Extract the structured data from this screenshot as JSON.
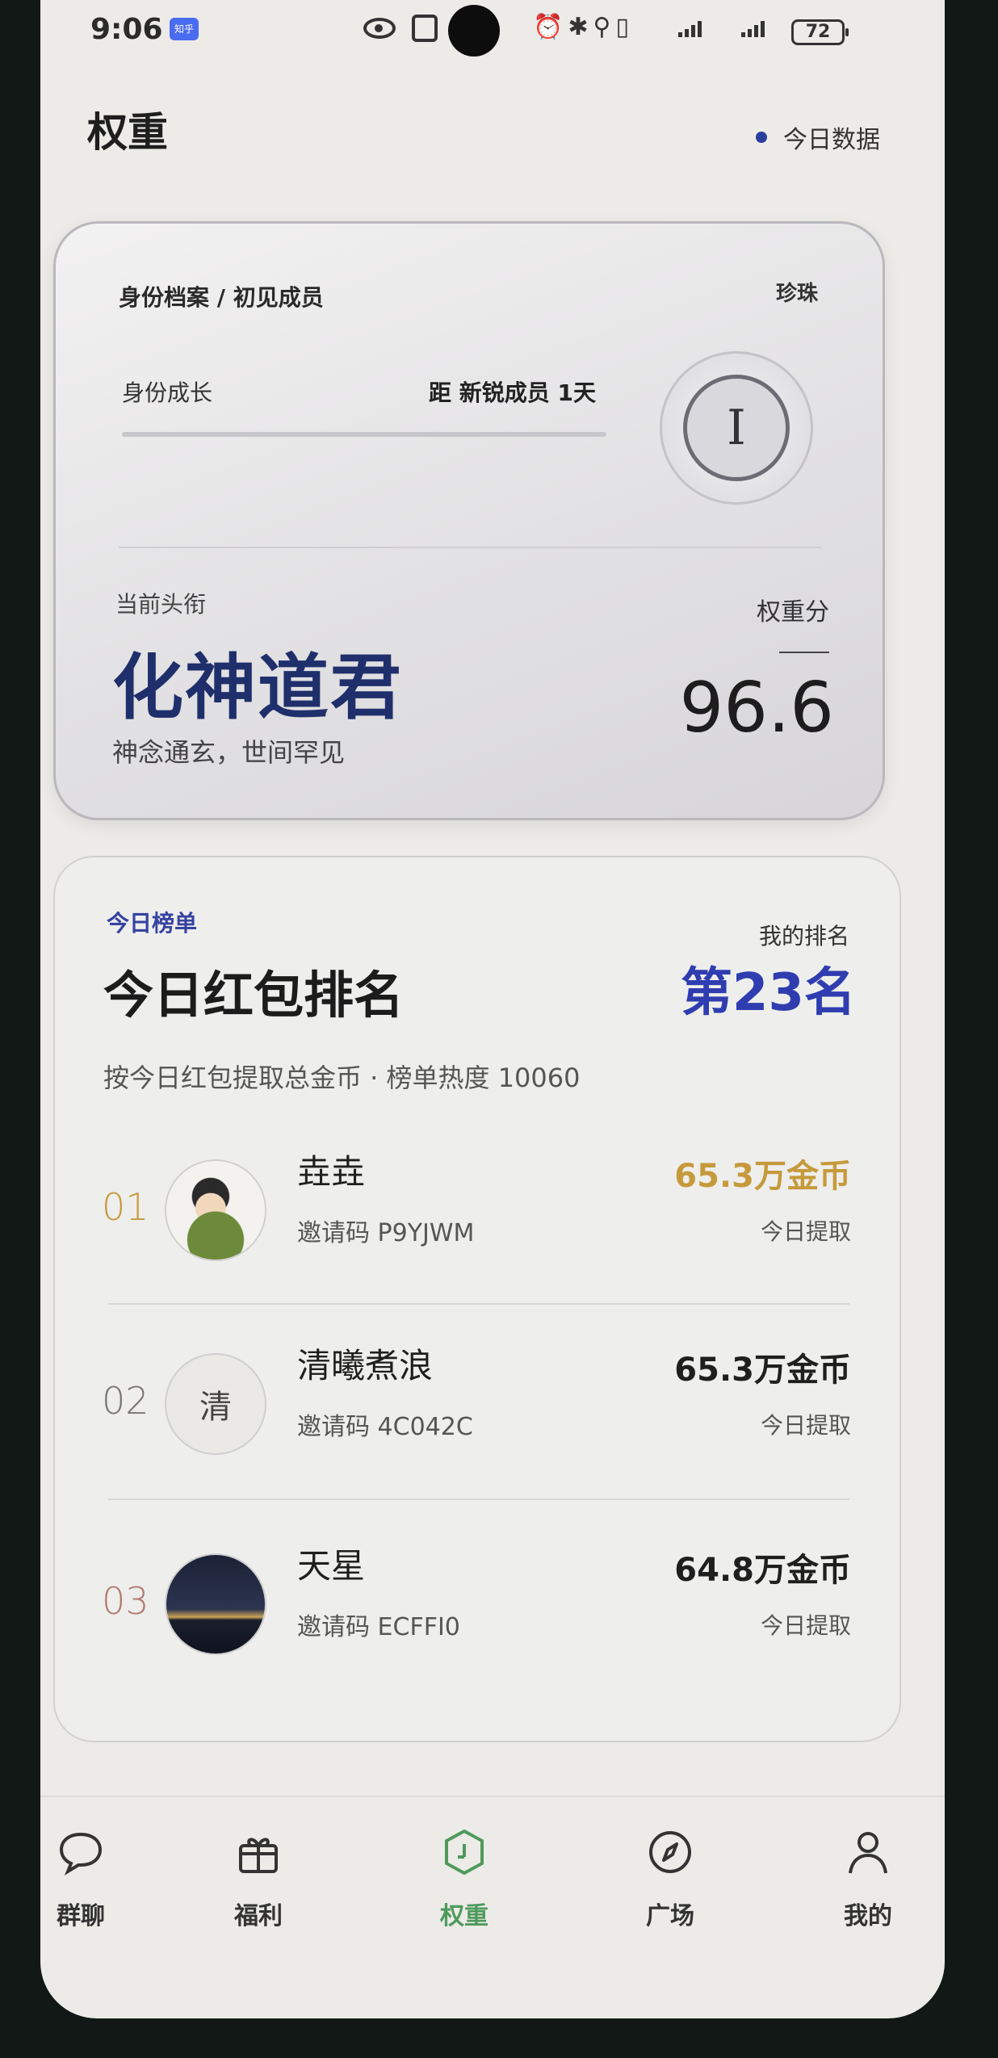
{
  "status_bar": {
    "time": "9:06",
    "app_badge": "知乎",
    "battery": "72"
  },
  "header": {
    "title": "权重",
    "today_data": "今日数据"
  },
  "profile": {
    "breadcrumb": "身份档案 / 初见成员",
    "level_name": "珍珠",
    "growth_label": "身份成长",
    "next_level": "距 新锐成员 1天",
    "growth_progress": 0.0,
    "dial_numeral": "I",
    "current_title_label": "当前头衔",
    "current_title": "化神道君",
    "title_desc": "神念通玄，世间罕见",
    "score_label": "权重分",
    "score": "96.6"
  },
  "ranking": {
    "tag": "今日榜单",
    "title": "今日红包排名",
    "my_rank_label": "我的排名",
    "my_rank": "第23名",
    "description": "按今日红包提取总金币 · 榜单热度 10060",
    "rows": [
      {
        "rank": "01",
        "name": "垚垚",
        "code": "邀请码   P9YJWM",
        "amount": "65.3万金币",
        "sub": "今日提取",
        "avatar_text": ""
      },
      {
        "rank": "02",
        "name": "清曦煮浪",
        "code": "邀请码   4C042C",
        "amount": "65.3万金币",
        "sub": "今日提取",
        "avatar_text": "清"
      },
      {
        "rank": "03",
        "name": "天星",
        "code": "邀请码   ECFFI0",
        "amount": "64.8万金币",
        "sub": "今日提取",
        "avatar_text": ""
      }
    ]
  },
  "nav": {
    "items": [
      {
        "label": "群聊",
        "icon": "chat-bubble-icon"
      },
      {
        "label": "福利",
        "icon": "gift-icon"
      },
      {
        "label": "权重",
        "icon": "weight-icon"
      },
      {
        "label": "广场",
        "icon": "compass-icon"
      },
      {
        "label": "我的",
        "icon": "person-icon"
      }
    ],
    "active": "权重"
  },
  "colors": {
    "accent_blue": "#2f3db0",
    "title_navy": "#1f2f6b",
    "gold": "#c69a3c",
    "active_green": "#4e9a5b"
  }
}
